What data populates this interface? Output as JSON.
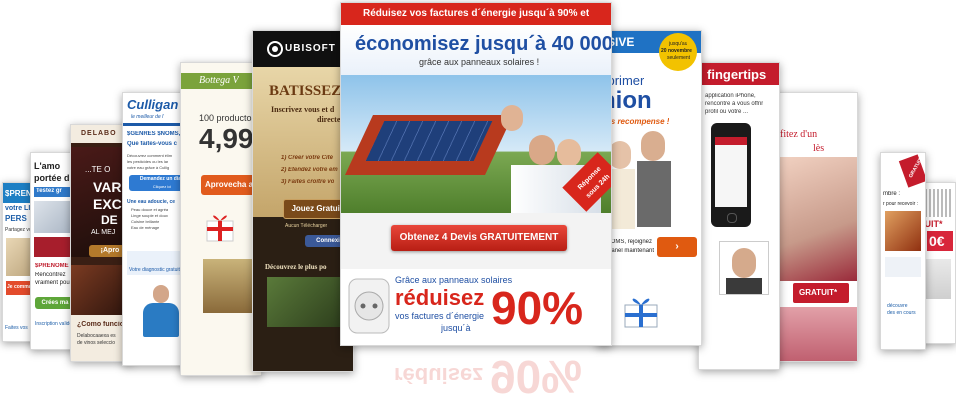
{
  "colors": {
    "main_red": "#d8261c",
    "main_blue": "#1f4fa3",
    "bottega_green": "#7ba33c",
    "culligan_blue": "#1c5aa8",
    "dark_brown": "#3b2a1a",
    "gold": "#f2c200"
  },
  "main": {
    "headline_top": "Réduisez vos factures d´énergie jusqu´à 90% et",
    "headline_big": "économisez jusqu´à 40 000 €",
    "headline_sub": "grâce aux panneaux solaires !",
    "badge_line1": "Réponse",
    "badge_line2": "sous 24h",
    "cta_label": "Obtenez 4 Devis GRATUITEMENT",
    "bottom_line1": "Grâce aux panneaux solaires",
    "bottom_big": "réduisez",
    "bottom_line2": "vos factures d´énergie",
    "bottom_line3": "jusqu´à",
    "bottom_percent": "90%"
  },
  "ubisoft": {
    "logo": "UBISOFT",
    "title": "BATISSEZ",
    "line1": "Inscrivez vous et d",
    "line2": "directemen",
    "step1": "1) Créer votre Cité",
    "step2": "2) Etendez votre em",
    "step3": "3) Faites croître vo",
    "button": "Jouez Gratuit",
    "button_sub": "Aucun Télécharger",
    "connect": "Connexi",
    "footer": "Découvrez le plus po"
  },
  "bottega": {
    "logo": "Bottega V",
    "line1": "100 productos",
    "price": "4,99",
    "button": "Aprovecha ah"
  },
  "culligan": {
    "logo": "Culligan",
    "tagline": "le meilleur de l'",
    "greeting": "$GENRES $NOMS,",
    "question": "Que faites-vous c",
    "p1": "Découvrez comment élim",
    "p2": "les pesticides ou les lar",
    "p3": "votre eau grâce à Cullig",
    "cta": "Demandez un diag",
    "cta_sub": "Cliquez ici",
    "list_title": "Une eau adoucie, ce",
    "li1": "Peau douce et agréa",
    "li2": "Linge souple et doux",
    "li3": "Cuisine brillante",
    "li4": "Eau de ménage",
    "footer": "Votre diagnostic gratuit"
  },
  "delaboca": {
    "brand": "DELABO",
    "te_o": "...TE O",
    "big1": "VAR",
    "big2": "EXC",
    "big3": "DE",
    "al": "AL MEJ",
    "button": "¡Apro",
    "como": "¿Como funcio",
    "como_sub1": "Delabocaaexa es",
    "como_sub2": "de vinos seleccio"
  },
  "left2": {
    "title1": "L'amo",
    "title2": "portée d",
    "blue1": "Testez gr",
    "red1": "$PRENOME",
    "text1": "Rencontrez",
    "text2": "vraiment pou",
    "button": "Crées ma",
    "footer": "Inscription valide"
  },
  "left1": {
    "title1": "$PRENO",
    "title2": "votre LIV",
    "title3": "PERS",
    "sub": "Partagez vos",
    "footer": "Faites vos",
    "btn": "Je commande"
  },
  "exprimer": {
    "band": "SIVE",
    "badge1": "jusqu'au",
    "badge2": "20 novembre",
    "badge3": "seulement",
    "title1": "xprimer",
    "title2": "nion",
    "sub": "ons recompense !",
    "line1": "$NOMS, rejoignez",
    "line2": "e panel maintenant"
  },
  "fingertips": {
    "title": "fingertips",
    "p1": "application iPhone,",
    "p2": "rencontre à vous offrir",
    "p3": "profil ou votre ..."
  },
  "lingerie": {
    "title1": "ofitez d'un",
    "title2": "lès",
    "footer": "GRATUIT*"
  },
  "right2": {
    "text1": "mbre :",
    "text2": "r pour recevoir :",
    "footer1": "découvre",
    "footer2": "des en cours"
  },
  "right1": {
    "badge": "GRATUIT",
    "big": "TUIT*",
    "price": "0€"
  }
}
